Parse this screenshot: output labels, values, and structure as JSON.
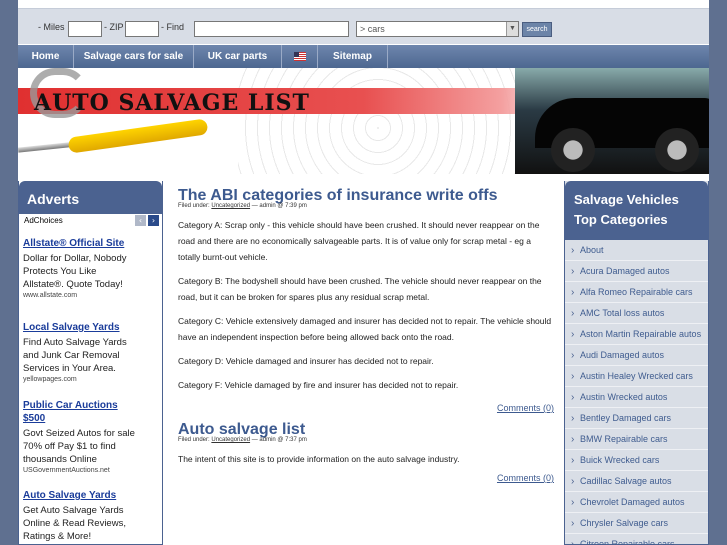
{
  "search": {
    "miles_label": "- Miles",
    "zip_label": "- ZIP",
    "find_label": "- Find",
    "miles_value": "",
    "zip_value": "",
    "find_value": "",
    "category_value": "> cars",
    "button_label": "search"
  },
  "nav": {
    "items": [
      "Home",
      "Salvage cars for sale",
      "UK car parts",
      "Sitemap"
    ]
  },
  "banner": {
    "title": "AUTO SALVAGE LIST"
  },
  "adverts": {
    "heading": "Adverts",
    "adchoices": "AdChoices",
    "ads": [
      {
        "title": "Allstate® Official Site",
        "desc": "Dollar for Dollar, Nobody Protects You Like Allstate®. Quote Today!",
        "url": "www.allstate.com"
      },
      {
        "title": "Local Salvage Yards",
        "desc": "Find Auto Salvage Yards and Junk Car Removal Services in Your Area.",
        "url": "yellowpages.com"
      },
      {
        "title": "Public Car Auctions $500",
        "desc": "Govt Seized Autos for sale 70% off Pay $1 to find thousands Online",
        "url": "USGovernmentAuctions.net"
      },
      {
        "title": "Auto Salvage Yards",
        "desc": "Get Auto Salvage Yards Online & Read Reviews, Ratings & More!",
        "url": ""
      }
    ]
  },
  "posts": [
    {
      "title": "The ABI categories of insurance write offs",
      "filed_prefix": "Filed under:",
      "filed_category": "Uncategorized",
      "filed_suffix": "— admin @ 7:39 pm",
      "paragraphs": [
        "Category A: Scrap only - this vehicle should have been crushed. It should never reappear on the road and there are no economically salvageable parts. It is of value only for scrap metal - eg a totally burnt-out vehicle.",
        "Category B: The bodyshell should have been crushed. The vehicle should never reappear on the road, but it can be broken for spares plus any residual scrap metal.",
        "Category C: Vehicle extensively damaged and insurer has decided not to repair. The vehicle should have an independent inspection before being allowed back onto the road.",
        "Category D: Vehicle damaged and insurer has decided not to repair.",
        "Category F: Vehicle damaged by fire and insurer has decided not to repair."
      ],
      "comments": "Comments (0)"
    },
    {
      "title": "Auto salvage list",
      "filed_prefix": "Filed under:",
      "filed_category": "Uncategorized",
      "filed_suffix": "— admin @ 7:37 pm",
      "paragraphs": [
        "The intent of this site is to provide information on the auto salvage industry."
      ],
      "comments": "Comments (0)"
    }
  ],
  "sidebar": {
    "heading1": "Salvage Vehicles",
    "heading2": "Top Categories",
    "categories": [
      "About",
      "Acura Damaged autos",
      "Alfa Romeo Repairable cars",
      "AMC Total loss autos",
      "Aston Martin Repairable autos",
      "Audi Damaged autos",
      "Austin Healey Wrecked cars",
      "Austin Wrecked autos",
      "Bentley Damaged cars",
      "BMW Repairable cars",
      "Buick Wrecked cars",
      "Cadillac Salvage autos",
      "Chevrolet Damaged autos",
      "Chrysler Salvage cars",
      "Citroen Repairable cars"
    ]
  },
  "colors": {
    "accent": "#4b6290",
    "link": "#3d5a8f",
    "banner_red": "#e03030",
    "background": "#5f7090"
  }
}
